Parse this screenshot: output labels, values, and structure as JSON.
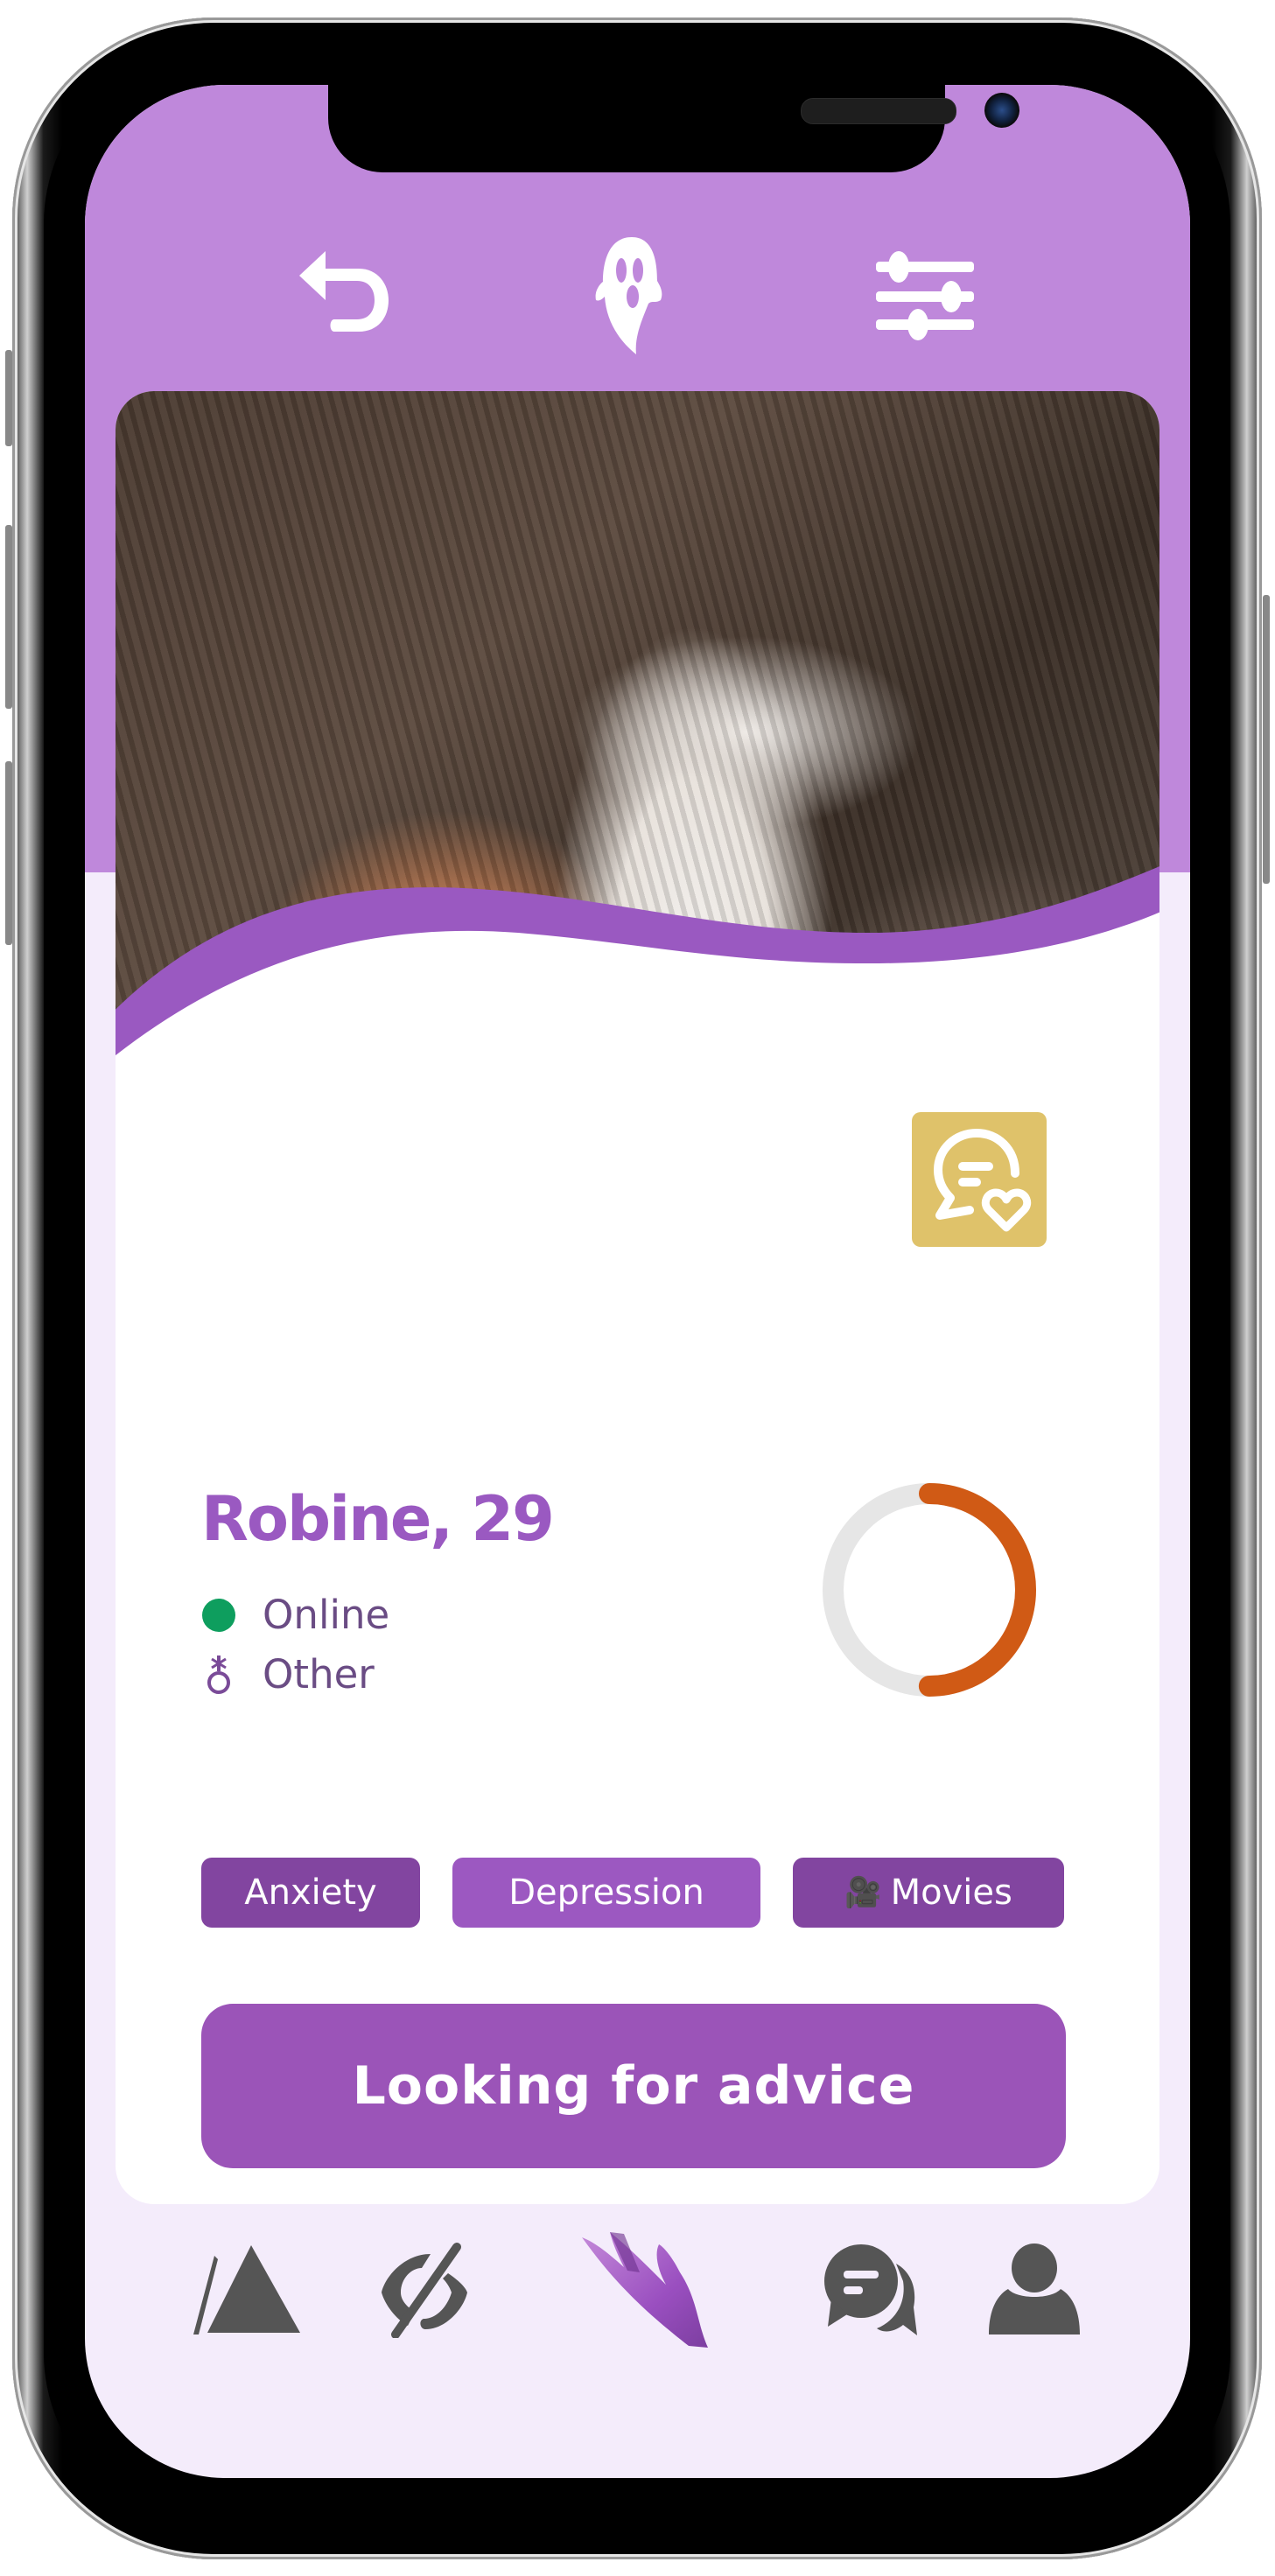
{
  "header": {
    "back_icon": "undo-arrow-icon",
    "center_icon": "ghost-icon",
    "filter_icon": "sliders-icon",
    "background_color": "#bf88db"
  },
  "profile": {
    "name_age": "Robine, 29",
    "status": {
      "label": "Online",
      "icon": "online-dot-icon",
      "color": "#0e9e5e"
    },
    "gender": {
      "label": "Other",
      "icon": "gender-other-icon"
    },
    "match_ring": {
      "progress": 0.5,
      "fill_color": "#d05a15",
      "track_color": "#e6e6e6"
    },
    "chat_badge_icon": "chat-heart-icon"
  },
  "tags": [
    {
      "label": "Anxiety",
      "icon": ""
    },
    {
      "label": "Depression",
      "icon": ""
    },
    {
      "label": "Movies",
      "icon": "🎥"
    }
  ],
  "cta": {
    "label": "Looking for advice"
  },
  "bottom_nav": [
    {
      "name": "discover",
      "icon": "triangle-icon",
      "active": false
    },
    {
      "name": "hidden",
      "icon": "eye-slash-icon",
      "active": false
    },
    {
      "name": "help",
      "icon": "hand-icon",
      "active": true
    },
    {
      "name": "messages",
      "icon": "chat-bubbles-icon",
      "active": false
    },
    {
      "name": "profile",
      "icon": "user-icon",
      "active": false
    }
  ],
  "colors": {
    "accent": "#9b54b8",
    "accent_dark": "#8245a0",
    "icon_gray": "#555555",
    "nav_bg": "#f4ecfb"
  }
}
